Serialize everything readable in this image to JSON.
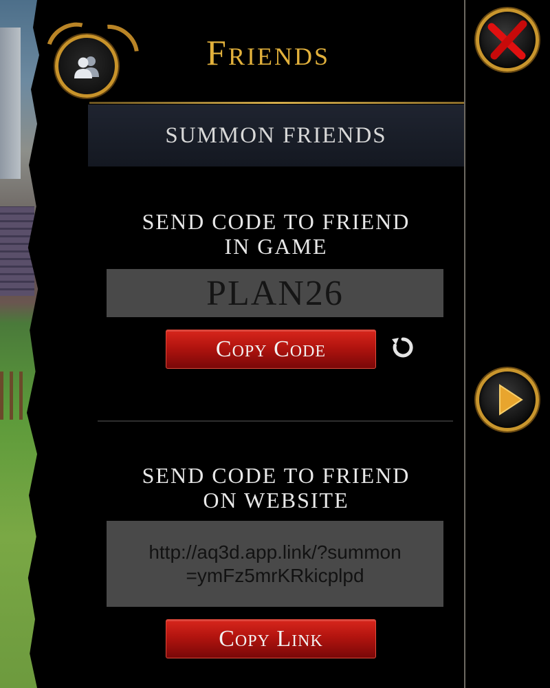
{
  "header": {
    "title": "Friends",
    "subtitle": "SUMMON FRIENDS",
    "emblem_icon": "friends-icon",
    "close_icon": "close-x-icon"
  },
  "in_game": {
    "heading_line1": "SEND CODE TO FRIEND",
    "heading_line2": "IN GAME",
    "code": "PLAN26",
    "copy_label": "Copy Code",
    "refresh_icon": "refresh-icon"
  },
  "website": {
    "heading_line1": "SEND CODE TO FRIEND",
    "heading_line2": "ON WEBSITE",
    "link_line1": "http://aq3d.app.link/?summon",
    "link_line2": "=ymFz5mrKRkicplpd",
    "copy_label": "Copy Link"
  },
  "nav": {
    "next_icon": "play-arrow-icon"
  },
  "colors": {
    "title_gold": "#e2b13c",
    "button_red": "#b2140f",
    "field_gray": "#494949"
  }
}
